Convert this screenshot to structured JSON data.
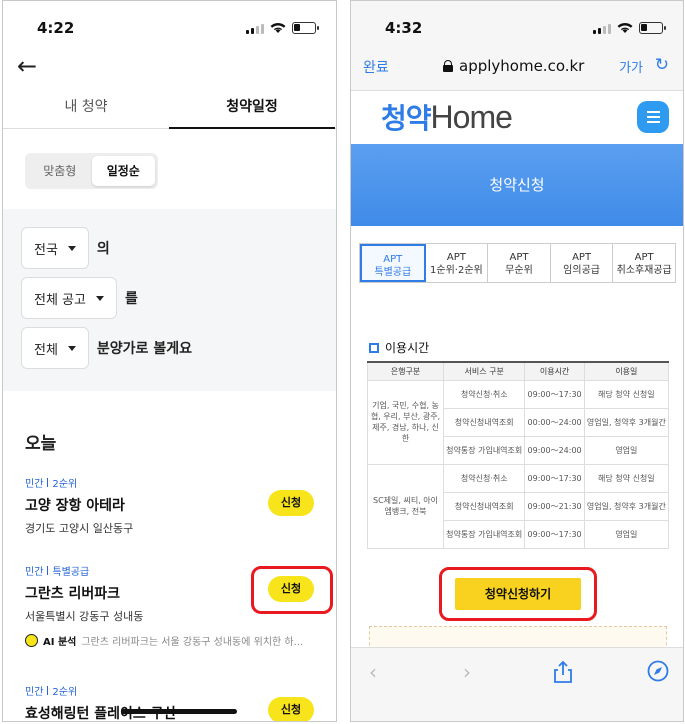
{
  "left": {
    "status": {
      "time": "4:22"
    },
    "tabs": [
      "내 청약",
      "청약일정"
    ],
    "segment": [
      "맞춤형",
      "일정순"
    ],
    "filters": [
      {
        "value": "전국",
        "suffix": "의"
      },
      {
        "value": "전체 공고",
        "suffix": "를"
      },
      {
        "value": "전체",
        "suffix": "분양가로 볼게요"
      }
    ],
    "section_title": "오늘",
    "items": [
      {
        "tag1": "민간",
        "tag2": "2순위",
        "name": "고양 장항 아테라",
        "address": "경기도 고양시 일산동구",
        "button": "신청"
      },
      {
        "tag1": "민간",
        "tag2": "특별공급",
        "name": "그란츠 리버파크",
        "address": "서울특별시 강동구 성내동",
        "button": "신청"
      },
      {
        "tag1": "민간",
        "tag2": "2순위",
        "name": "효성해링턴 플레이스 구산",
        "address": "",
        "button": "신청"
      }
    ],
    "ai": {
      "label": "AI 분석",
      "text": "그란츠 리버파크는 서울 강동구 성내동에 위치한 하..."
    },
    "highlight_color": "#e8191f",
    "button_color": "#f8e41b"
  },
  "right": {
    "status": {
      "time": "4:32"
    },
    "nav": {
      "done": "완료",
      "url": "applyhome.co.kr",
      "text_size": "가가"
    },
    "logo": {
      "prefix": "청약",
      "suffix": "Home"
    },
    "banner": "청약신청",
    "apt_tabs": [
      {
        "l1": "APT",
        "l2": "특별공급"
      },
      {
        "l1": "APT",
        "l2": "1순위·2순위"
      },
      {
        "l1": "APT",
        "l2": "무순위"
      },
      {
        "l1": "APT",
        "l2": "임의공급"
      },
      {
        "l1": "APT",
        "l2": "취소후재공급"
      }
    ],
    "section": "이용시간",
    "table": {
      "headers": [
        "은행구분",
        "서비스 구분",
        "이용시간",
        "이용일"
      ],
      "groups": [
        {
          "bank": "기업, 국민, 수협, 농협, 우리, 부산, 광주, 제주, 경남, 하나, 신한",
          "rows": [
            [
              "청약신청·취소",
              "09:00～17:30",
              "해당 청약 신청일"
            ],
            [
              "청약신청내역조회",
              "00:00～24:00",
              "영업일, 청약후 3개월간"
            ],
            [
              "청약통장 가입내역조회",
              "09:00～24:00",
              "영업일"
            ]
          ]
        },
        {
          "bank": "SC제일, 씨티, 아이엠뱅크, 전북",
          "rows": [
            [
              "청약신청·취소",
              "09:00～17:30",
              "해당 청약 신청일"
            ],
            [
              "청약신청내역조회",
              "09:00～21:30",
              "영업일, 청약후 3개월간"
            ],
            [
              "청약통장 가입내역조회",
              "09:00～17:30",
              "영업일"
            ]
          ]
        }
      ]
    },
    "apply_button": "청약신청하기",
    "accent_color": "#2f7ce6"
  }
}
